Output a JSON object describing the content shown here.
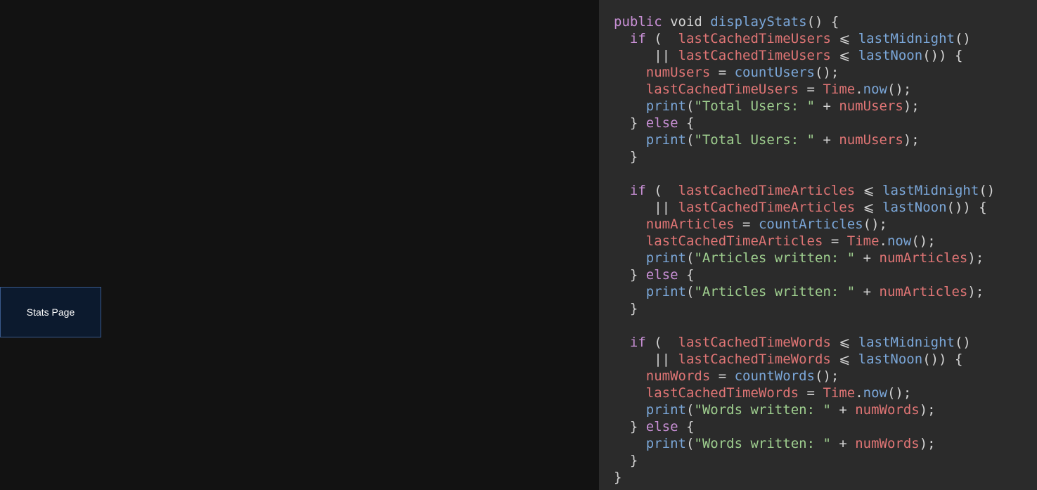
{
  "stats_button": {
    "label": "Stats Page"
  },
  "code": {
    "lines": [
      [
        {
          "t": "public",
          "c": "kw"
        },
        {
          "t": " void ",
          "c": "plain"
        },
        {
          "t": "displayStats",
          "c": "fn"
        },
        {
          "t": "() {",
          "c": "plain"
        }
      ],
      [
        {
          "t": "  ",
          "c": "plain"
        },
        {
          "t": "if",
          "c": "kw"
        },
        {
          "t": " (  ",
          "c": "plain"
        },
        {
          "t": "lastCachedTimeUsers",
          "c": "var"
        },
        {
          "t": " ⩽ ",
          "c": "plain"
        },
        {
          "t": "lastMidnight",
          "c": "fn"
        },
        {
          "t": "()",
          "c": "plain"
        }
      ],
      [
        {
          "t": "     || ",
          "c": "plain"
        },
        {
          "t": "lastCachedTimeUsers",
          "c": "var"
        },
        {
          "t": " ⩽ ",
          "c": "plain"
        },
        {
          "t": "lastNoon",
          "c": "fn"
        },
        {
          "t": "()) {",
          "c": "plain"
        }
      ],
      [
        {
          "t": "    ",
          "c": "plain"
        },
        {
          "t": "numUsers",
          "c": "var"
        },
        {
          "t": " = ",
          "c": "plain"
        },
        {
          "t": "countUsers",
          "c": "fn"
        },
        {
          "t": "();",
          "c": "plain"
        }
      ],
      [
        {
          "t": "    ",
          "c": "plain"
        },
        {
          "t": "lastCachedTimeUsers",
          "c": "var"
        },
        {
          "t": " = ",
          "c": "plain"
        },
        {
          "t": "Time",
          "c": "cls"
        },
        {
          "t": ".",
          "c": "plain"
        },
        {
          "t": "now",
          "c": "fn"
        },
        {
          "t": "();",
          "c": "plain"
        }
      ],
      [
        {
          "t": "    ",
          "c": "plain"
        },
        {
          "t": "print",
          "c": "fn"
        },
        {
          "t": "(",
          "c": "plain"
        },
        {
          "t": "\"Total Users: \"",
          "c": "str"
        },
        {
          "t": " + ",
          "c": "plain"
        },
        {
          "t": "numUsers",
          "c": "var"
        },
        {
          "t": ");",
          "c": "plain"
        }
      ],
      [
        {
          "t": "  } ",
          "c": "plain"
        },
        {
          "t": "else",
          "c": "kw"
        },
        {
          "t": " {",
          "c": "plain"
        }
      ],
      [
        {
          "t": "    ",
          "c": "plain"
        },
        {
          "t": "print",
          "c": "fn"
        },
        {
          "t": "(",
          "c": "plain"
        },
        {
          "t": "\"Total Users: \"",
          "c": "str"
        },
        {
          "t": " + ",
          "c": "plain"
        },
        {
          "t": "numUsers",
          "c": "var"
        },
        {
          "t": ");",
          "c": "plain"
        }
      ],
      [
        {
          "t": "  }",
          "c": "plain"
        }
      ],
      [
        {
          "t": "",
          "c": "plain"
        }
      ],
      [
        {
          "t": "  ",
          "c": "plain"
        },
        {
          "t": "if",
          "c": "kw"
        },
        {
          "t": " (  ",
          "c": "plain"
        },
        {
          "t": "lastCachedTimeArticles",
          "c": "var"
        },
        {
          "t": " ⩽ ",
          "c": "plain"
        },
        {
          "t": "lastMidnight",
          "c": "fn"
        },
        {
          "t": "()",
          "c": "plain"
        }
      ],
      [
        {
          "t": "     || ",
          "c": "plain"
        },
        {
          "t": "lastCachedTimeArticles",
          "c": "var"
        },
        {
          "t": " ⩽ ",
          "c": "plain"
        },
        {
          "t": "lastNoon",
          "c": "fn"
        },
        {
          "t": "()) {",
          "c": "plain"
        }
      ],
      [
        {
          "t": "    ",
          "c": "plain"
        },
        {
          "t": "numArticles",
          "c": "var"
        },
        {
          "t": " = ",
          "c": "plain"
        },
        {
          "t": "countArticles",
          "c": "fn"
        },
        {
          "t": "();",
          "c": "plain"
        }
      ],
      [
        {
          "t": "    ",
          "c": "plain"
        },
        {
          "t": "lastCachedTimeArticles",
          "c": "var"
        },
        {
          "t": " = ",
          "c": "plain"
        },
        {
          "t": "Time",
          "c": "cls"
        },
        {
          "t": ".",
          "c": "plain"
        },
        {
          "t": "now",
          "c": "fn"
        },
        {
          "t": "();",
          "c": "plain"
        }
      ],
      [
        {
          "t": "    ",
          "c": "plain"
        },
        {
          "t": "print",
          "c": "fn"
        },
        {
          "t": "(",
          "c": "plain"
        },
        {
          "t": "\"Articles written: \"",
          "c": "str"
        },
        {
          "t": " + ",
          "c": "plain"
        },
        {
          "t": "numArticles",
          "c": "var"
        },
        {
          "t": ");",
          "c": "plain"
        }
      ],
      [
        {
          "t": "  } ",
          "c": "plain"
        },
        {
          "t": "else",
          "c": "kw"
        },
        {
          "t": " {",
          "c": "plain"
        }
      ],
      [
        {
          "t": "    ",
          "c": "plain"
        },
        {
          "t": "print",
          "c": "fn"
        },
        {
          "t": "(",
          "c": "plain"
        },
        {
          "t": "\"Articles written: \"",
          "c": "str"
        },
        {
          "t": " + ",
          "c": "plain"
        },
        {
          "t": "numArticles",
          "c": "var"
        },
        {
          "t": ");",
          "c": "plain"
        }
      ],
      [
        {
          "t": "  }",
          "c": "plain"
        }
      ],
      [
        {
          "t": "",
          "c": "plain"
        }
      ],
      [
        {
          "t": "  ",
          "c": "plain"
        },
        {
          "t": "if",
          "c": "kw"
        },
        {
          "t": " (  ",
          "c": "plain"
        },
        {
          "t": "lastCachedTimeWords",
          "c": "var"
        },
        {
          "t": " ⩽ ",
          "c": "plain"
        },
        {
          "t": "lastMidnight",
          "c": "fn"
        },
        {
          "t": "()",
          "c": "plain"
        }
      ],
      [
        {
          "t": "     || ",
          "c": "plain"
        },
        {
          "t": "lastCachedTimeWords",
          "c": "var"
        },
        {
          "t": " ⩽ ",
          "c": "plain"
        },
        {
          "t": "lastNoon",
          "c": "fn"
        },
        {
          "t": "()) {",
          "c": "plain"
        }
      ],
      [
        {
          "t": "    ",
          "c": "plain"
        },
        {
          "t": "numWords",
          "c": "var"
        },
        {
          "t": " = ",
          "c": "plain"
        },
        {
          "t": "countWords",
          "c": "fn"
        },
        {
          "t": "();",
          "c": "plain"
        }
      ],
      [
        {
          "t": "    ",
          "c": "plain"
        },
        {
          "t": "lastCachedTimeWords",
          "c": "var"
        },
        {
          "t": " = ",
          "c": "plain"
        },
        {
          "t": "Time",
          "c": "cls"
        },
        {
          "t": ".",
          "c": "plain"
        },
        {
          "t": "now",
          "c": "fn"
        },
        {
          "t": "();",
          "c": "plain"
        }
      ],
      [
        {
          "t": "    ",
          "c": "plain"
        },
        {
          "t": "print",
          "c": "fn"
        },
        {
          "t": "(",
          "c": "plain"
        },
        {
          "t": "\"Words written: \"",
          "c": "str"
        },
        {
          "t": " + ",
          "c": "plain"
        },
        {
          "t": "numWords",
          "c": "var"
        },
        {
          "t": ");",
          "c": "plain"
        }
      ],
      [
        {
          "t": "  } ",
          "c": "plain"
        },
        {
          "t": "else",
          "c": "kw"
        },
        {
          "t": " {",
          "c": "plain"
        }
      ],
      [
        {
          "t": "    ",
          "c": "plain"
        },
        {
          "t": "print",
          "c": "fn"
        },
        {
          "t": "(",
          "c": "plain"
        },
        {
          "t": "\"Words written: \"",
          "c": "str"
        },
        {
          "t": " + ",
          "c": "plain"
        },
        {
          "t": "numWords",
          "c": "var"
        },
        {
          "t": ");",
          "c": "plain"
        }
      ],
      [
        {
          "t": "  }",
          "c": "plain"
        }
      ],
      [
        {
          "t": "}",
          "c": "plain"
        }
      ]
    ]
  }
}
